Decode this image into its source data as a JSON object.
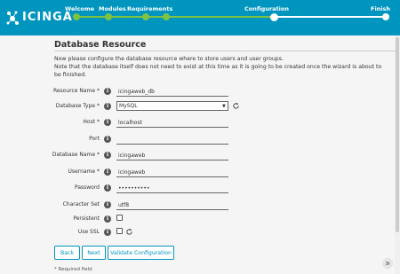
{
  "header": {
    "logo_text": "icinga",
    "steps": [
      {
        "label": "Welcome",
        "state": "done"
      },
      {
        "label": "Modules",
        "state": "done"
      },
      {
        "label": "Requirements",
        "state": "done"
      },
      {
        "label": "Configuration",
        "state": "current"
      },
      {
        "label": "Finish",
        "state": "todo"
      }
    ],
    "colors": {
      "brand": "#0095bf",
      "progress_done": "#7fc241",
      "progress_todo": "#ffffff"
    }
  },
  "main": {
    "title": "Database Resource",
    "intro_line1": "Now please configure the database resource where to store users and user groups.",
    "intro_line2": "Note that the database itself does not need to exist at this time as it is going to be created once the wizard is about to be finished."
  },
  "form": {
    "resource_name": {
      "label": "Resource Name *",
      "value": "icingaweb_db"
    },
    "database_type": {
      "label": "Database Type *",
      "value": "MySQL"
    },
    "host": {
      "label": "Host *",
      "value": "localhost"
    },
    "port": {
      "label": "Port",
      "value": ""
    },
    "database_name": {
      "label": "Database Name *",
      "value": "icingaweb"
    },
    "username": {
      "label": "Username *",
      "value": "icingaweb"
    },
    "password": {
      "label": "Password",
      "value": "••••••••••"
    },
    "character_set": {
      "label": "Character Set",
      "value": "utf8"
    },
    "persistent": {
      "label": "Persistent",
      "checked": false
    },
    "use_ssl": {
      "label": "Use SSL",
      "checked": false
    }
  },
  "buttons": {
    "back": "Back",
    "next": "Next",
    "validate": "Validate Configuration"
  },
  "footer": {
    "required_note": "* Required field"
  }
}
